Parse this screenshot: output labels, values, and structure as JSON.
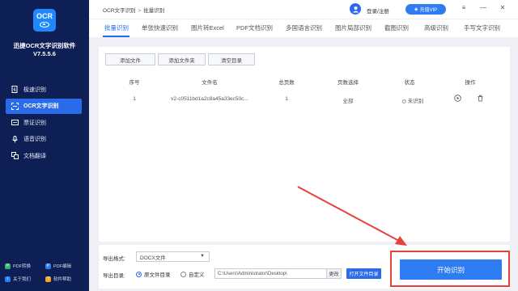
{
  "app": {
    "logo_text": "OCR",
    "name": "迅捷OCR文字识别软件",
    "version": "V7.5.5.6"
  },
  "sidebar": {
    "items": [
      {
        "label": "极速识别",
        "icon": "lightning-doc-icon"
      },
      {
        "label": "OCR文字识别",
        "icon": "ocr-scan-icon"
      },
      {
        "label": "票证识别",
        "icon": "ticket-icon"
      },
      {
        "label": "语音识别",
        "icon": "microphone-icon"
      },
      {
        "label": "文档翻译",
        "icon": "translate-icon"
      }
    ],
    "bottom": [
      {
        "label": "PDF转换",
        "color": "#2eb873"
      },
      {
        "label": "PDF编辑",
        "color": "#2d7cf2"
      },
      {
        "label": "关于我们",
        "color": "#2d7cf2"
      },
      {
        "label": "软件帮助",
        "color": "#f5a623"
      }
    ]
  },
  "topbar": {
    "breadcrumb_root": "OCR文字识别",
    "breadcrumb_sep": ">",
    "breadcrumb_current": "批量识别",
    "login": "登录/注册",
    "vip": "充值VIP",
    "controls": [
      "≡",
      "—",
      "✕"
    ]
  },
  "tabs": [
    "批量识别",
    "单张快速识别",
    "图片转Excel",
    "PDF文档识别",
    "多国语言识别",
    "图片局部识别",
    "截图识别",
    "高级识别",
    "手写文字识别"
  ],
  "toolbar": {
    "add_file": "添加文件",
    "add_folder": "添加文件夹",
    "clear": "清空目录"
  },
  "table": {
    "headers": [
      "序号",
      "文件名",
      "总页数",
      "页数选择",
      "状态",
      "操作"
    ],
    "rows": [
      {
        "index": "1",
        "filename": "v2-c0511bd1a2c8a45a33ec50c...",
        "pages": "1",
        "page_select": "全部",
        "status": "未识别"
      }
    ]
  },
  "bottom": {
    "format_label": "导出格式:",
    "format_value": "DOCX文件",
    "dir_label": "导出目录:",
    "radio_original": "原文件目录",
    "radio_custom": "自定义",
    "path": "C:\\Users\\Administrator\\Desktop\\",
    "change": "更改",
    "open_dir": "打开文件目录",
    "start": "开始识别"
  },
  "colors": {
    "accent": "#2a6bea",
    "sidebar_bg": "#0d1f55",
    "annotation": "#e8403a"
  }
}
